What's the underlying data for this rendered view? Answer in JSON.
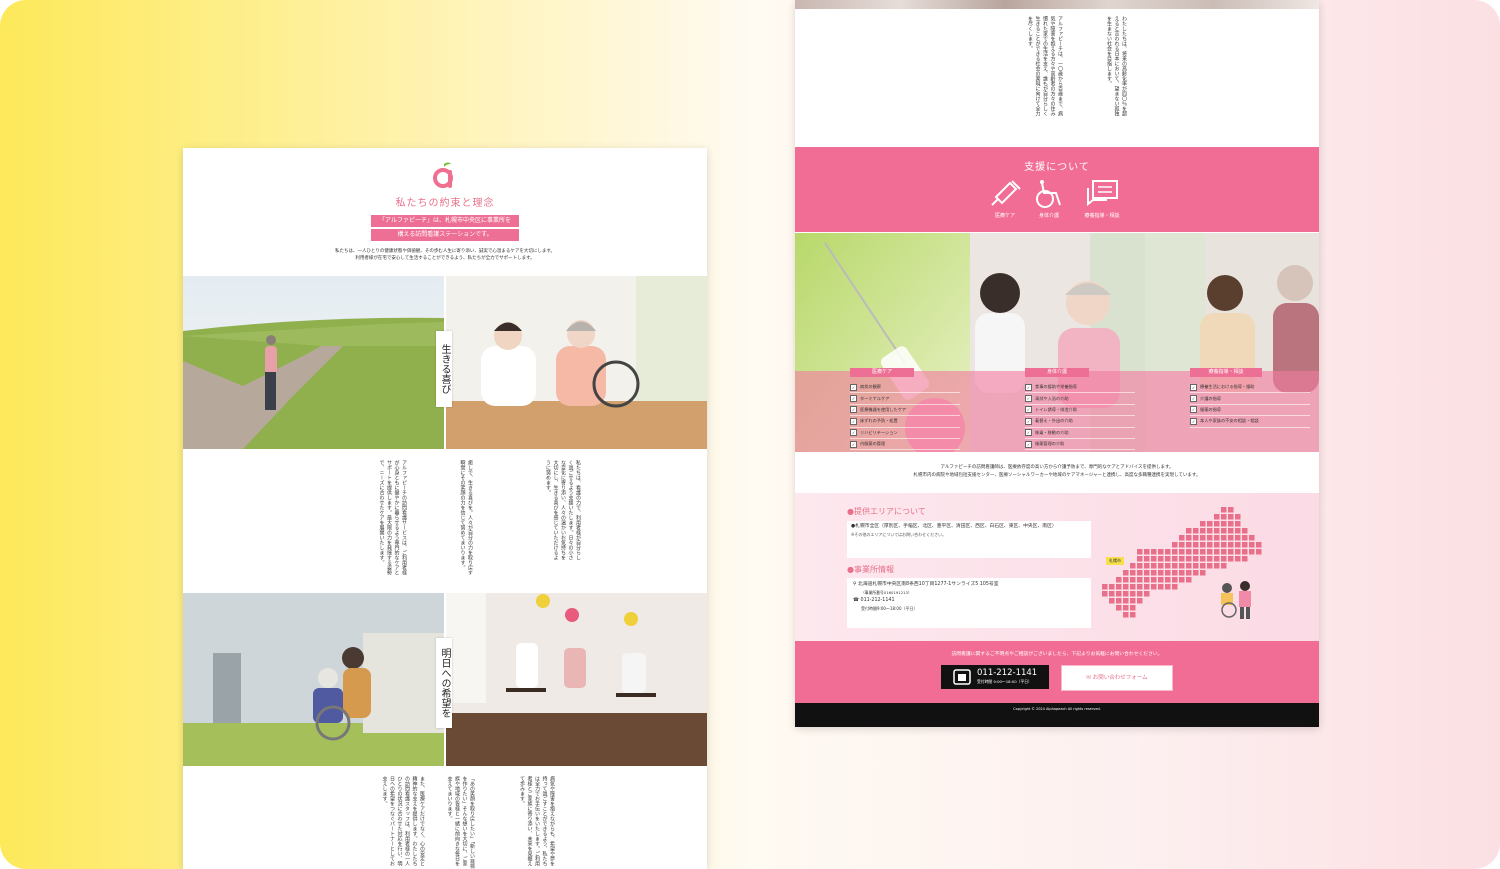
{
  "left": {
    "title": "私たちの約束と理念",
    "banner_line1": "「アルファピーチ」は、札幌市中央区に事業所を",
    "banner_line2": "構える訪問看護ステーションです。",
    "intro_line1": "私たちは、一人ひとりの健康状態や価値観、その歩む人生に寄り添い、誠実で心温まるケアを大切にします。",
    "intro_line2": "利用者様が在宅で安心して生活することができるよう、私たちが全力でサポートします。",
    "label_joy": "生きる喜び",
    "label_hope": "明日への希望を",
    "text_joy_a": "私たちは、看護の力で、利用者様が自分らしく過ごせるよう支援いたします。日々の小さな変化に寄り添い、人々の温かいお気持ちを大切にし、生きる喜びを感じていただけるように努めます。",
    "text_joy_b": "癒しで、生きる喜びを。人々が自分の力を取り戻す瞬間にその笑顔の力を信じて努めてまいります。",
    "text_joy_c": "アルファピーチの訪問看護サービスは、ご利用者様が心身ともに健やかに暮らせるよう専門的なケアとサポートを提供します。最大限の力を発揮する姿勢で、ニーズに合わせたケアを展開いたします。",
    "text_hope_a": "病気や障害を抱えながらも、希望や夢を持って過ごすことができるよう、私たちは全力でお手伝いをいたします。ご利用者様とご家族に寄り添い、未来を見据えて歩みます。",
    "text_hope_b": "「あの笑顔を取り戻したい」「新しい目標を作りたい」そんな想いを大切に、ご家族や地域の皆様と一緒に前向きな毎日を支えてまいります。",
    "text_hope_c": "また、医療ケアだけでなく、心の安定と精神的な支えを提供します。わたしたちの訪問看護スタッフは、利用者様の一人ひとりの状況に合わせた対応を行い、明日への希望をつなぐパートナーとしてお支えします。"
  },
  "right": {
    "top_text_a": "わたしたちは、将来の高齢化率が四〇％を超えると言われる日本において、望まない孤独を生まない社会を目指します。",
    "top_text_b": "アルファピーチは、一〇歳から百歳まで、病気や障害を抱える方々や高齢者の方々の住み慣れた家での生活を支え、誰もが自分らしく生きることができる社会の実現に向けて全力を尽くします。",
    "support_title": "支援について",
    "support_items": [
      {
        "label": "医療ケア",
        "icon": "syringe-icon"
      },
      {
        "label": "身体介護",
        "icon": "wheelchair-icon"
      },
      {
        "label": "療養指導・相談",
        "icon": "chat-icon"
      }
    ],
    "services": [
      {
        "badge": "医療ケア",
        "items": [
          "病状の観察",
          "ターミナルケア",
          "医療機器を使用したケア",
          "床ずれの予防・処置",
          "リハビリテーション",
          "内服薬の管理"
        ]
      },
      {
        "badge": "身体介護",
        "items": [
          "食事の援助や栄養指導",
          "清拭や入浴の介助",
          "トイレ誘導・排泄介助",
          "着替え・外出の介助",
          "移乗・移動の介助",
          "服薬管理の介助"
        ]
      },
      {
        "badge": "療養指導・相談",
        "items": [
          "療養生活における指導・援助",
          "介護の指導",
          "服薬の指導",
          "本人や家族の不安の相談・相談"
        ]
      }
    ],
    "desc_line1": "アルファピーチの訪問看護師は、医療依存度の高い方から介護予防まで、専門的なケアとアドバイスを提供します。",
    "desc_line2": "札幌市内の病院や地域包括支援センター、医療ソーシャルワーカーや地域のケアマネージャーと連携し、高度な多職種連携を実現しています。",
    "area_head": "●提供エリアについて",
    "area_text": "●札幌市全区（厚別区、手稲区、北区、豊平区、清田区、西区、白石区、東区、中央区、南区）",
    "area_note": "※その他のエリアについてはお問い合わせください。",
    "office_head": "●事業所情報",
    "office_address": "北海道札幌市中央区南8条西10丁目1277-1サンライズ5 105号室",
    "office_reg": "（事業所番号0160191213）",
    "office_tel": "011-212-1141",
    "office_hours": "受付時間9:00～18:00（平日）",
    "map_label": "札幌市",
    "contact_note": "訪問看護に関するご不明点やご相談がございましたら、下記よりお気軽にお問い合わせください。",
    "tel_number": "011-212-1141",
    "tel_hours": "受付時間 9:00～18:00（平日）",
    "mail_label": "お問い合わせフォーム",
    "copyright": "Copyright © 2024 Alphapeach All rights reserved."
  }
}
